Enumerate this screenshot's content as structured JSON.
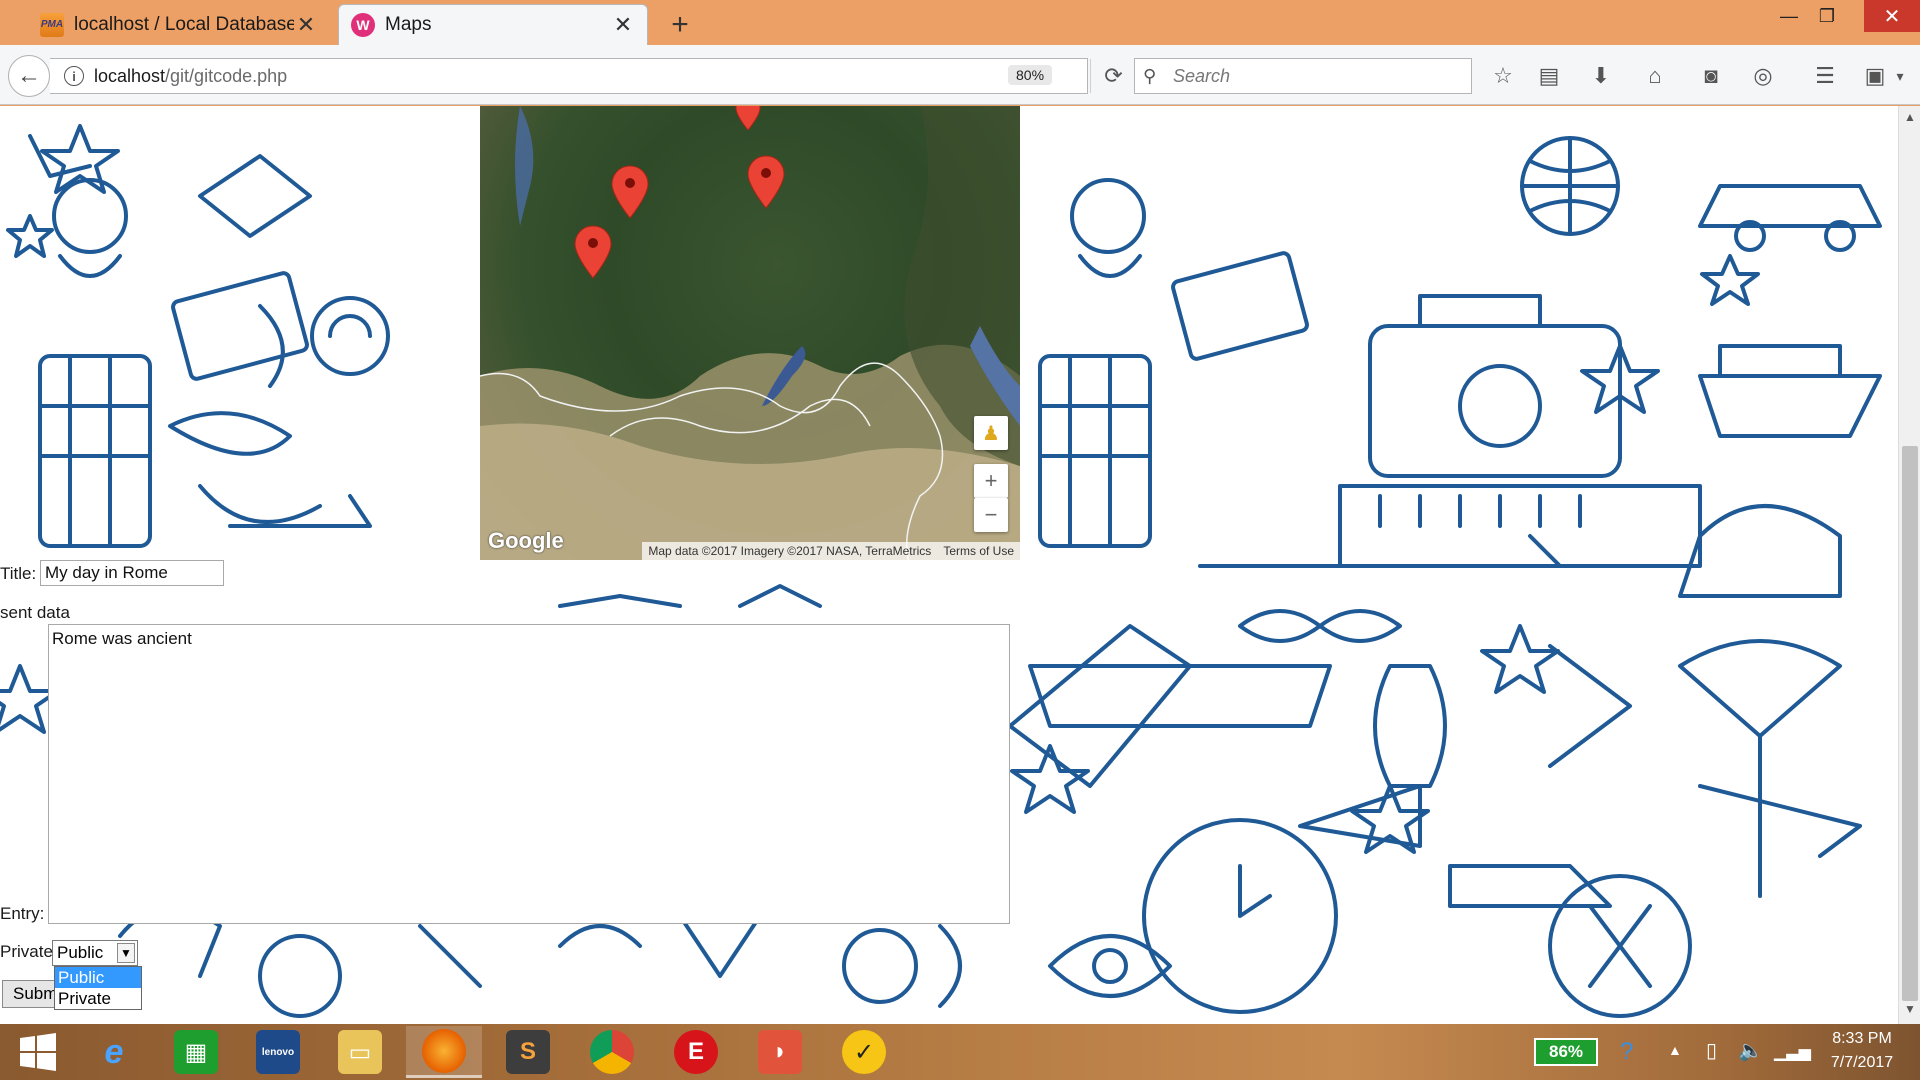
{
  "browser": {
    "tabs": [
      {
        "title": "localhost / Local Databases",
        "active": false,
        "favicon": "phpmyadmin-icon"
      },
      {
        "title": "Maps",
        "active": true,
        "favicon": "wamp-icon"
      }
    ],
    "url_host": "localhost",
    "url_path": "/git/gitcode.php",
    "zoom": "80%",
    "search_placeholder": "Search"
  },
  "map": {
    "google_logo": "Google",
    "attribution": "Map data ©2017 Imagery ©2017 NASA, TerraMetrics",
    "terms": "Terms of Use",
    "zoom_in": "+",
    "zoom_out": "−"
  },
  "form": {
    "title_label": "Title:",
    "title_value": "My day in Rome",
    "sent_data_text": "sent data",
    "entry_label": "Entry:",
    "entry_value": "Rome was ancient",
    "privacy_label": "Private",
    "privacy_selected": "Public",
    "privacy_options": [
      "Public",
      "Private"
    ],
    "submit_label": "Submit"
  },
  "taskbar": {
    "battery": "86%",
    "time": "8:33 PM",
    "date": "7/7/2017",
    "apps": [
      "start",
      "internet-explorer",
      "store",
      "lenovo",
      "file-explorer",
      "firefox",
      "sublime-text",
      "chrome",
      "e-app",
      "red-app",
      "norton"
    ]
  },
  "colors": {
    "titlebar": "#eda065",
    "doodle_blue": "#1f5a96",
    "close_red": "#c9382b",
    "battery_green": "#1e9e2e",
    "select_highlight": "#3399ff"
  }
}
